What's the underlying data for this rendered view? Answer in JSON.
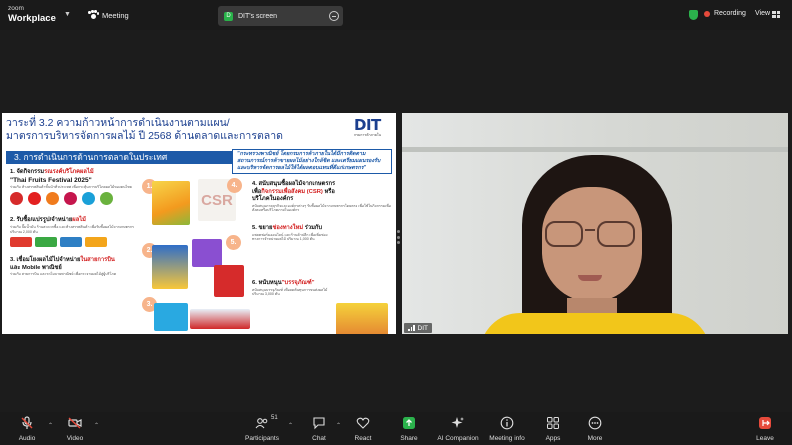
{
  "topbar": {
    "logo_line1": "zoom",
    "logo_line2": "Workplace",
    "meeting_label": "Meeting",
    "screen_badge": "D",
    "screen_label": "DIT's screen",
    "recording_label": "Recording",
    "view_label": "View",
    "colors": {
      "recording": "#e64a3b",
      "shield": "#2bb24c"
    }
  },
  "slide": {
    "title_line1": "วาระที่ 3.2 ความก้าวหน้าการดำเนินงานตามแผน/",
    "title_line2": "มาตรการบริหารจัดการผลไม้ ปี 2568 ด้านตลาดและการตลาด",
    "logo_text": "DIT",
    "logo_sub": "กรมการค้าภายใน",
    "section": "3. การดำเนินการด้านการตลาดในประเทศ",
    "quote": "\"กระทรวงพาณิชย์ โดยกรมการค้าภายในได้มีการติดตามสถานการณ์การค้าขายผลไม้อย่างใกล้ชิด และเตรียมแผนรองรับและบริหารจัดการผลไม้ให้ได้ผลตอบแทนที่ดีแก่เกษตรกร\"",
    "item1_head": "1. จัดกิจกรรม",
    "item1_head_red": "รณรงค์บริโภคผลไม้",
    "item1_festival": "\"Thai Fruits Festival 2025\"",
    "item1_desc": "ร่วมกับ ห้างสรรพสินค้าชั้นนำทั่วประเทศ เพื่อกระตุ้นการบริโภคผลไม้ของคนไทย",
    "item2_head": "2. รับซื้อ/แปรรูป/จำหน่าย",
    "item2_head_red": "ผลไม้",
    "item2_desc": "ร่วมกับ ปั๊มน้ำมัน ร้านสะดวกซื้อ และห้างสรรพสินค้า เพื่อรับซื้อผลไม้จากเกษตรกร ปริมาณ 2,000 ตัน",
    "item3_head": "3. เชื่อมโยงผลไม้ไปจำหน่าย",
    "item3_head_red": "ในสายการบิน",
    "item3_head2": "และ Mobile พาณิชย์",
    "item3_desc": "ร่วมกับ สายการบิน และรถโมบายพาณิชย์ เพื่อกระจายผลไม้สู่ผู้บริโภค",
    "num1": "1.",
    "num2": "2.",
    "num3": "3.",
    "num4": "4.",
    "num5": "5.",
    "csr": "CSR",
    "item4_head": "4. สนับสนุนซื้อผลไม้จากเกษตรกร",
    "item4_head2": "เพื่อ",
    "item4_head2_red": "กิจกรรมเพื่อสังคม (CSR)",
    "item4_head2_tail": " หรือ",
    "item4_head3": "บริโภคในองค์กร",
    "item4_desc": "สนับสนุนภาคธุรกิจและองค์กรต่างๆ รับซื้อผลไม้จากเกษตรกรโดยตรง เพื่อใช้ในกิจกรรมเพื่อสังคมหรือบริโภคภายในองค์กร",
    "item5_head": "5. ขยาย",
    "item5_head_red": "ช่องทางใหม่",
    "item5_head_tail": " ร่วมกับ",
    "item5_desc": "แพลตฟอร์มออนไลน์ และร้านค้าปลีก เพื่อเพิ่มช่องทางการจำหน่ายผลไม้ ปริมาณ 1,000 ตัน",
    "item6_head": "6. หนับหนุน",
    "item6_head_red": "\"บรรจุภัณฑ์\"",
    "item6_desc": "สนับสนุนบรรจุภัณฑ์ เพื่อลดต้นทุนการขนส่งผลไม้ ปริมาณ 3,000 ตัน"
  },
  "video": {
    "participant_name": "DIT"
  },
  "toolbar": {
    "audio": "Audio",
    "video": "Video",
    "participants": "Participants",
    "participants_count": "51",
    "chat": "Chat",
    "react": "React",
    "share": "Share",
    "ai_companion": "AI Companion",
    "meeting_info": "Meeting info",
    "apps": "Apps",
    "more": "More",
    "leave": "Leave",
    "colors": {
      "share": "#2bb24c",
      "leave": "#e64a3b",
      "muted": "#e64a3b"
    }
  }
}
